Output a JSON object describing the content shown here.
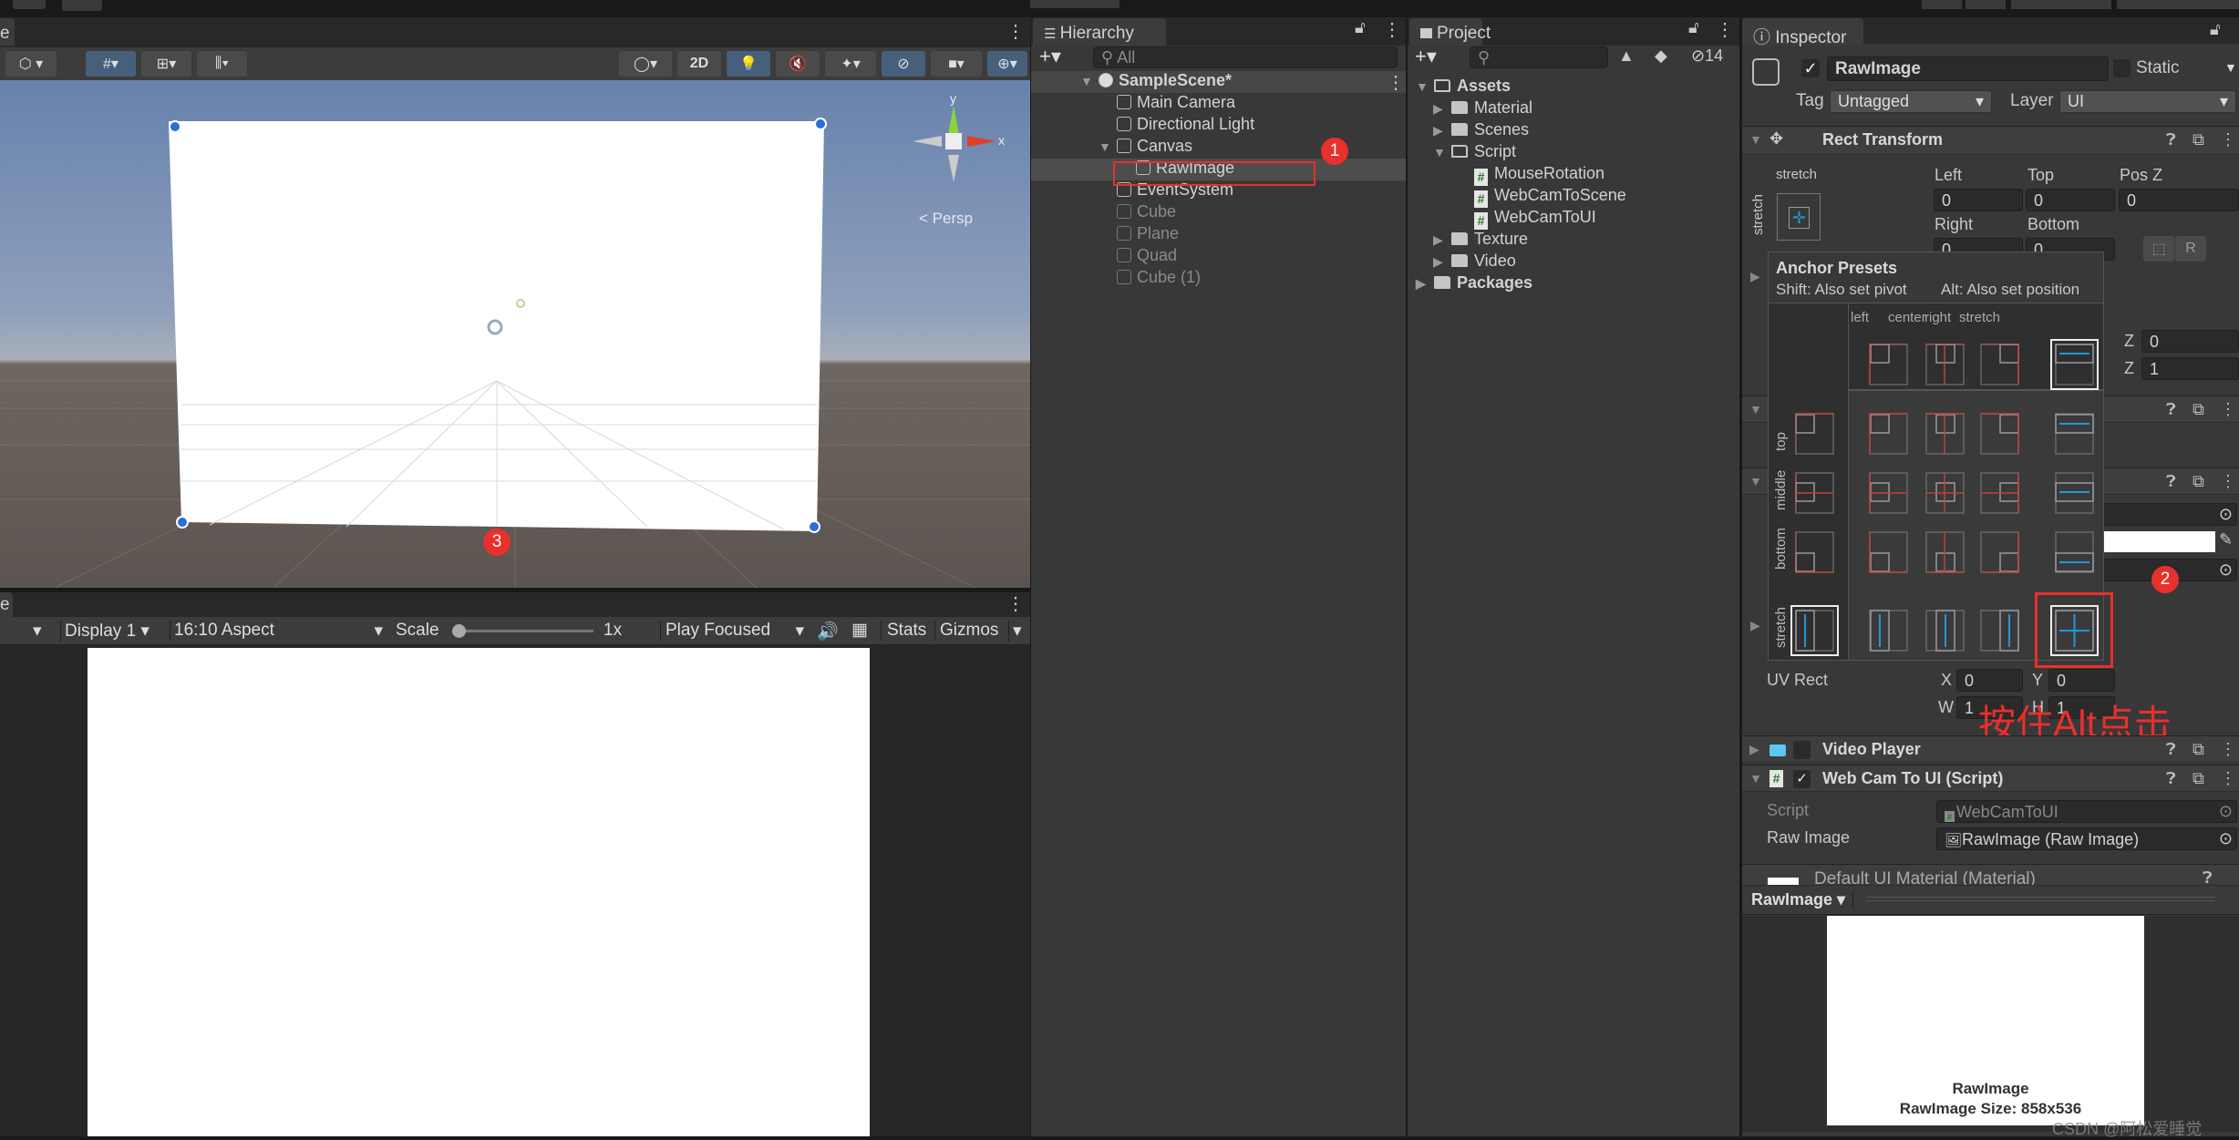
{
  "scene": {
    "tab_label": "e",
    "persp_label": "< Persp",
    "gizmo_axis_y": "y",
    "gizmo_axis_x": "x",
    "toolbar": {
      "mode_2d": "2D"
    }
  },
  "game": {
    "tab_label": "e",
    "display": "Display 1",
    "aspect": "16:10 Aspect",
    "scale_label": "Scale",
    "scale_value": "1x",
    "play_mode": "Play Focused",
    "stats": "Stats",
    "gizmos": "Gizmos"
  },
  "hierarchy": {
    "tab_label": "Hierarchy",
    "search_placeholder": "All",
    "items": [
      {
        "label": "SampleScene*",
        "level": 0,
        "type": "scene",
        "expanded": true
      },
      {
        "label": "Main Camera",
        "level": 1,
        "type": "object"
      },
      {
        "label": "Directional Light",
        "level": 1,
        "type": "object"
      },
      {
        "label": "Canvas",
        "level": 1,
        "type": "object",
        "expanded": true
      },
      {
        "label": "RawImage",
        "level": 2,
        "type": "object",
        "selected": true
      },
      {
        "label": "EventSystem",
        "level": 1,
        "type": "object"
      },
      {
        "label": "Cube",
        "level": 1,
        "type": "object",
        "disabled": true
      },
      {
        "label": "Plane",
        "level": 1,
        "type": "object",
        "disabled": true
      },
      {
        "label": "Quad",
        "level": 1,
        "type": "object",
        "disabled": true
      },
      {
        "label": "Cube (1)",
        "level": 1,
        "type": "object",
        "disabled": true
      }
    ]
  },
  "project": {
    "tab_label": "Project",
    "hidden_count": "14",
    "items": [
      {
        "label": "Assets",
        "level": 0,
        "type": "folder-open",
        "expanded": true,
        "bold": true
      },
      {
        "label": "Material",
        "level": 1,
        "type": "folder",
        "collapsed": true
      },
      {
        "label": "Scenes",
        "level": 1,
        "type": "folder",
        "collapsed": true
      },
      {
        "label": "Script",
        "level": 1,
        "type": "folder-open",
        "expanded": true
      },
      {
        "label": "MouseRotation",
        "level": 2,
        "type": "script"
      },
      {
        "label": "WebCamToScene",
        "level": 2,
        "type": "script"
      },
      {
        "label": "WebCamToUI",
        "level": 2,
        "type": "script"
      },
      {
        "label": "Texture",
        "level": 1,
        "type": "folder",
        "collapsed": true
      },
      {
        "label": "Video",
        "level": 1,
        "type": "folder",
        "collapsed": true
      },
      {
        "label": "Packages",
        "level": 0,
        "type": "folder",
        "collapsed": true,
        "bold": true
      }
    ]
  },
  "inspector": {
    "tab_label": "Inspector",
    "object_name": "RawImage",
    "active": true,
    "static_label": "Static",
    "tag_label": "Tag",
    "tag_value": "Untagged",
    "layer_label": "Layer",
    "layer_value": "UI",
    "rect_transform": {
      "title": "Rect Transform",
      "anchor_h": "stretch",
      "anchor_v": "stretch",
      "left_label": "Left",
      "left": "0",
      "top_label": "Top",
      "top": "0",
      "posz_label": "Pos Z",
      "posz": "0",
      "right_label": "Right",
      "right": "0",
      "bottom_label": "Bottom",
      "bottom": "0",
      "raw_button": "R",
      "rot_z_label": "Z",
      "rot_z": "0",
      "scale_z_label": "Z",
      "scale_z": "1"
    },
    "anchor_presets": {
      "title": "Anchor Presets",
      "shift_hint": "Shift: Also set pivot",
      "alt_hint": "Alt: Also set position",
      "columns": [
        "left",
        "center",
        "right",
        "stretch"
      ],
      "rows": [
        "top",
        "middle",
        "bottom",
        "stretch"
      ],
      "selected": "stretch-stretch"
    },
    "uv_rect": {
      "label": "UV Rect",
      "x_label": "X",
      "x": "0",
      "y_label": "Y",
      "y": "0",
      "w_label": "W",
      "w": "1",
      "h_label": "H",
      "h": "1"
    },
    "video_player": {
      "title": "Video Player",
      "enabled": false
    },
    "webcam_script": {
      "title": "Web Cam To UI (Script)",
      "enabled": true,
      "script_label": "Script",
      "script_value": "WebCamToUI",
      "raw_image_label": "Raw Image",
      "raw_image_value": "RawImage (Raw Image)"
    },
    "material_title": "Default UI Material (Material)",
    "preview": {
      "dropdown": "RawImage",
      "caption": "RawImage",
      "size": "RawImage Size: 858x536"
    }
  },
  "annotations": {
    "step1": "1",
    "step2": "2",
    "step3": "3",
    "instruction": "按住Alt点击",
    "color": "#e8302c"
  },
  "watermark": "CSDN @阿松爱睡觉"
}
